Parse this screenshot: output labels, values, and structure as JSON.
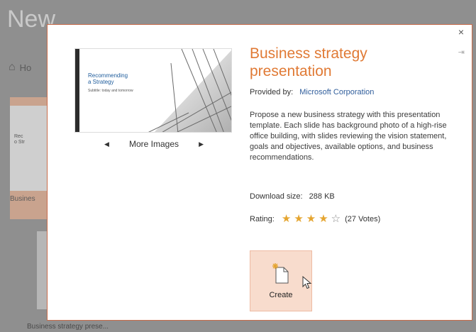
{
  "background": {
    "page_title": "New",
    "home_label": "Ho",
    "card_mini_title": "Rec\no Str",
    "card_caption": "Busines",
    "bottom_caption": "Business strategy prese..."
  },
  "dialog": {
    "close_label": "×",
    "pin_label": "⇥",
    "preview": {
      "slide_title": "Recommending\na Strategy",
      "slide_subtitle": "Subtitle: today and tomorrow"
    },
    "more_images": {
      "label": "More Images",
      "prev_icon": "triangle-left-icon",
      "next_icon": "triangle-right-icon"
    },
    "title": "Business strategy presentation",
    "provided_by_label": "Provided by:",
    "provider": "Microsoft Corporation",
    "description": "Propose a new business strategy with this presentation template. Each slide has background photo of a high-rise office building, with slides reviewing the vision statement, goals and objectives, available options, and business recommendations.",
    "download_label": "Download size:",
    "download_size": "288 KB",
    "rating_label": "Rating:",
    "rating_value": 4,
    "rating_max": 5,
    "votes": "(27 Votes)",
    "create_label": "Create"
  },
  "colors": {
    "accent_orange": "#e07a35",
    "provider_blue": "#2f5d9b",
    "create_bg": "#f8dccd",
    "star_gold": "#e5a530"
  }
}
